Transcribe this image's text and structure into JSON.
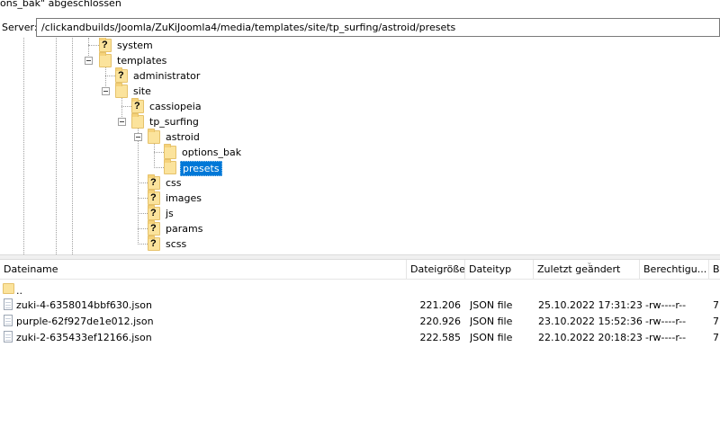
{
  "status": {
    "text": "ons_bak\" abgeschlossen"
  },
  "server_bar": {
    "label": "Server:",
    "path": "/clickandbuilds/Joomla/ZuKiJoomla4/media/templates/site/tp_surfing/astroid/presets"
  },
  "tree": {
    "nodes": [
      {
        "label": "system",
        "icon": "folder-unknown-icon"
      },
      {
        "label": "templates",
        "icon": "folder-icon"
      },
      {
        "label": "administrator",
        "icon": "folder-unknown-icon"
      },
      {
        "label": "site",
        "icon": "folder-icon"
      },
      {
        "label": "cassiopeia",
        "icon": "folder-unknown-icon"
      },
      {
        "label": "tp_surfing",
        "icon": "folder-icon"
      },
      {
        "label": "astroid",
        "icon": "folder-icon"
      },
      {
        "label": "options_bak",
        "icon": "folder-icon"
      },
      {
        "label": "presets",
        "icon": "folder-icon",
        "selected": true
      },
      {
        "label": "css",
        "icon": "folder-unknown-icon"
      },
      {
        "label": "images",
        "icon": "folder-unknown-icon"
      },
      {
        "label": "js",
        "icon": "folder-unknown-icon"
      },
      {
        "label": "params",
        "icon": "folder-unknown-icon"
      },
      {
        "label": "scss",
        "icon": "folder-unknown-icon"
      }
    ]
  },
  "file_list": {
    "columns": [
      "Dateiname",
      "Dateigröße",
      "Dateityp",
      "Zuletzt geändert",
      "Berechtigu...",
      "B"
    ],
    "up_dir": "..",
    "rows": [
      {
        "name": "zuki-4-6358014bbf630.json",
        "size": "221.206",
        "type": "JSON file",
        "modified": "25.10.2022 17:31:23",
        "perms": "-rw----r--",
        "owner": "7"
      },
      {
        "name": "purple-62f927de1e012.json",
        "size": "220.926",
        "type": "JSON file",
        "modified": "23.10.2022 15:52:36",
        "perms": "-rw----r--",
        "owner": "7"
      },
      {
        "name": "zuki-2-635433ef12166.json",
        "size": "222.585",
        "type": "JSON file",
        "modified": "22.10.2022 20:18:23",
        "perms": "-rw----r--",
        "owner": "7"
      }
    ]
  },
  "colors": {
    "selection": "#0078d7",
    "folder": "#fbe39c",
    "border": "#7a7a7a"
  }
}
